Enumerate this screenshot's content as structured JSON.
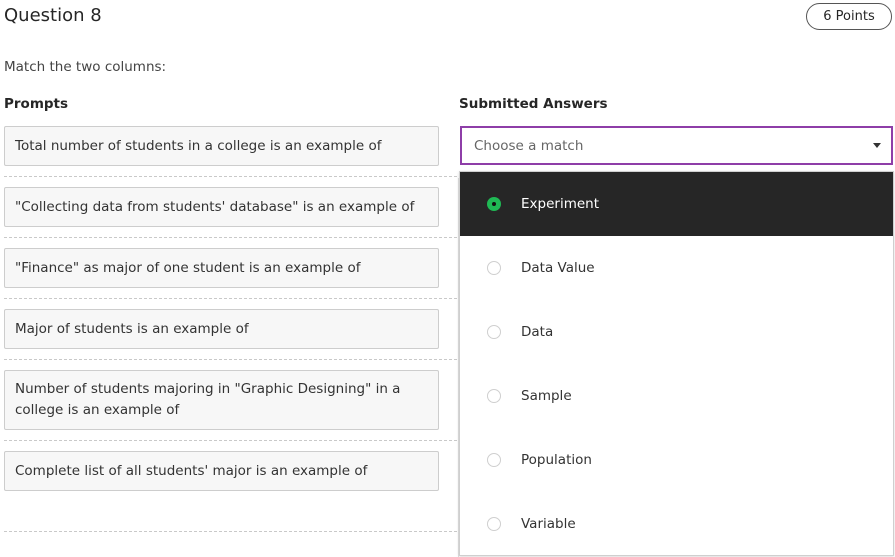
{
  "question": {
    "title": "Question 8",
    "points": "6 Points",
    "instructions": "Match the two columns:"
  },
  "columns": {
    "prompts_header": "Prompts",
    "answers_header": "Submitted Answers"
  },
  "prompts": [
    "Total number of students in a college is an example of",
    "\"Collecting data from students' database\" is an example of",
    "\"Finance\" as major of one student is an example of",
    "Major of students is an example of",
    "Number of students majoring in \"Graphic Designing\" in a college is an example of",
    "Complete list of all students' major is an example of"
  ],
  "select": {
    "placeholder": "Choose a match",
    "icon": "caret-down-icon"
  },
  "dropdown": {
    "highlighted_index": 0,
    "options": [
      "Experiment",
      "Data Value",
      "Data",
      "Sample",
      "Population",
      "Variable"
    ]
  },
  "colors": {
    "focus_border": "#8e3ea8",
    "highlight_bg": "#262626",
    "radio_selected": "#1fb954"
  }
}
